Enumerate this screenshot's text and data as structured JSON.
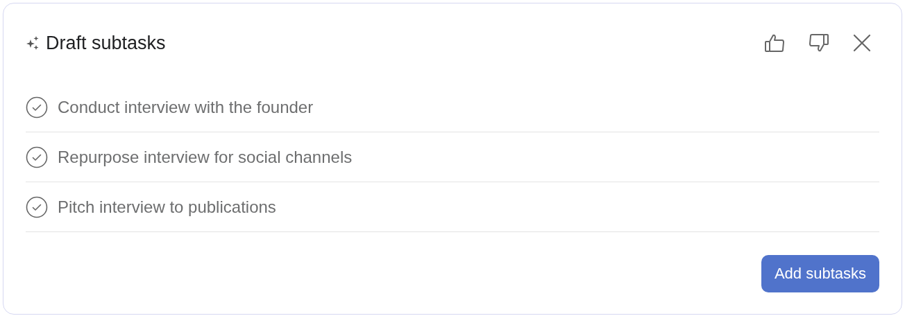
{
  "title": "Draft subtasks",
  "subtasks": [
    {
      "label": "Conduct interview with the founder"
    },
    {
      "label": "Repurpose interview for social channels"
    },
    {
      "label": "Pitch interview to publications"
    }
  ],
  "button": "Add subtasks"
}
